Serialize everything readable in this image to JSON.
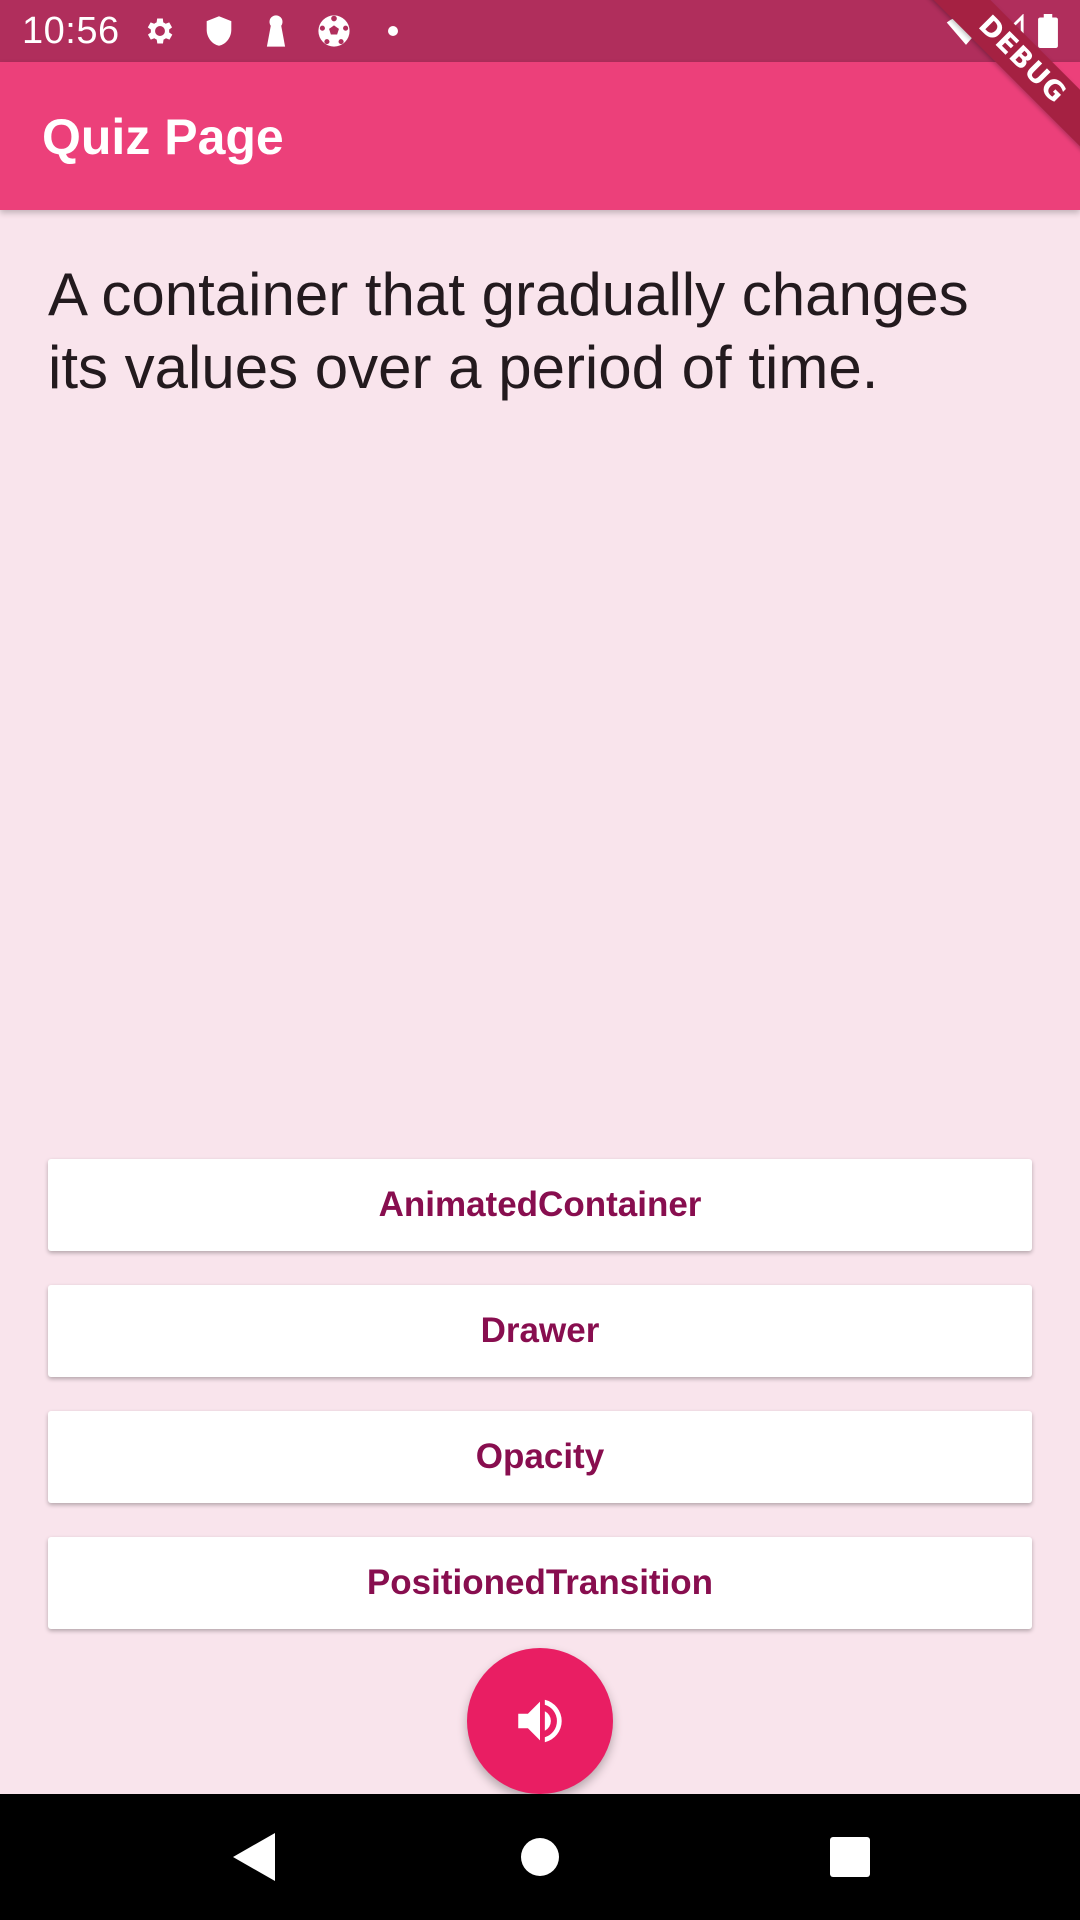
{
  "status_bar": {
    "time": "10:56",
    "icons": [
      "gear-icon",
      "shield-icon",
      "keyhole-icon",
      "soccer-ball-icon",
      "dot-icon",
      "wifi-icon",
      "signal-icon",
      "battery-icon"
    ]
  },
  "debug_banner": {
    "label": "DEBUG"
  },
  "app_bar": {
    "title": "Quiz Page"
  },
  "question": {
    "text": "A container that gradually changes its values over a period of time."
  },
  "answers": [
    {
      "label": "AnimatedContainer"
    },
    {
      "label": "Drawer"
    },
    {
      "label": "Opacity"
    },
    {
      "label": "PositionedTransition"
    }
  ],
  "fab": {
    "icon": "volume-up-icon"
  },
  "nav_bar": {
    "buttons": [
      "back-icon",
      "home-icon",
      "recents-icon"
    ]
  },
  "colors": {
    "status_bar": "#b02e5c",
    "app_bar": "#ec407a",
    "background": "#f9e4ec",
    "answer_text": "#880e4f",
    "fab": "#e91e63"
  }
}
